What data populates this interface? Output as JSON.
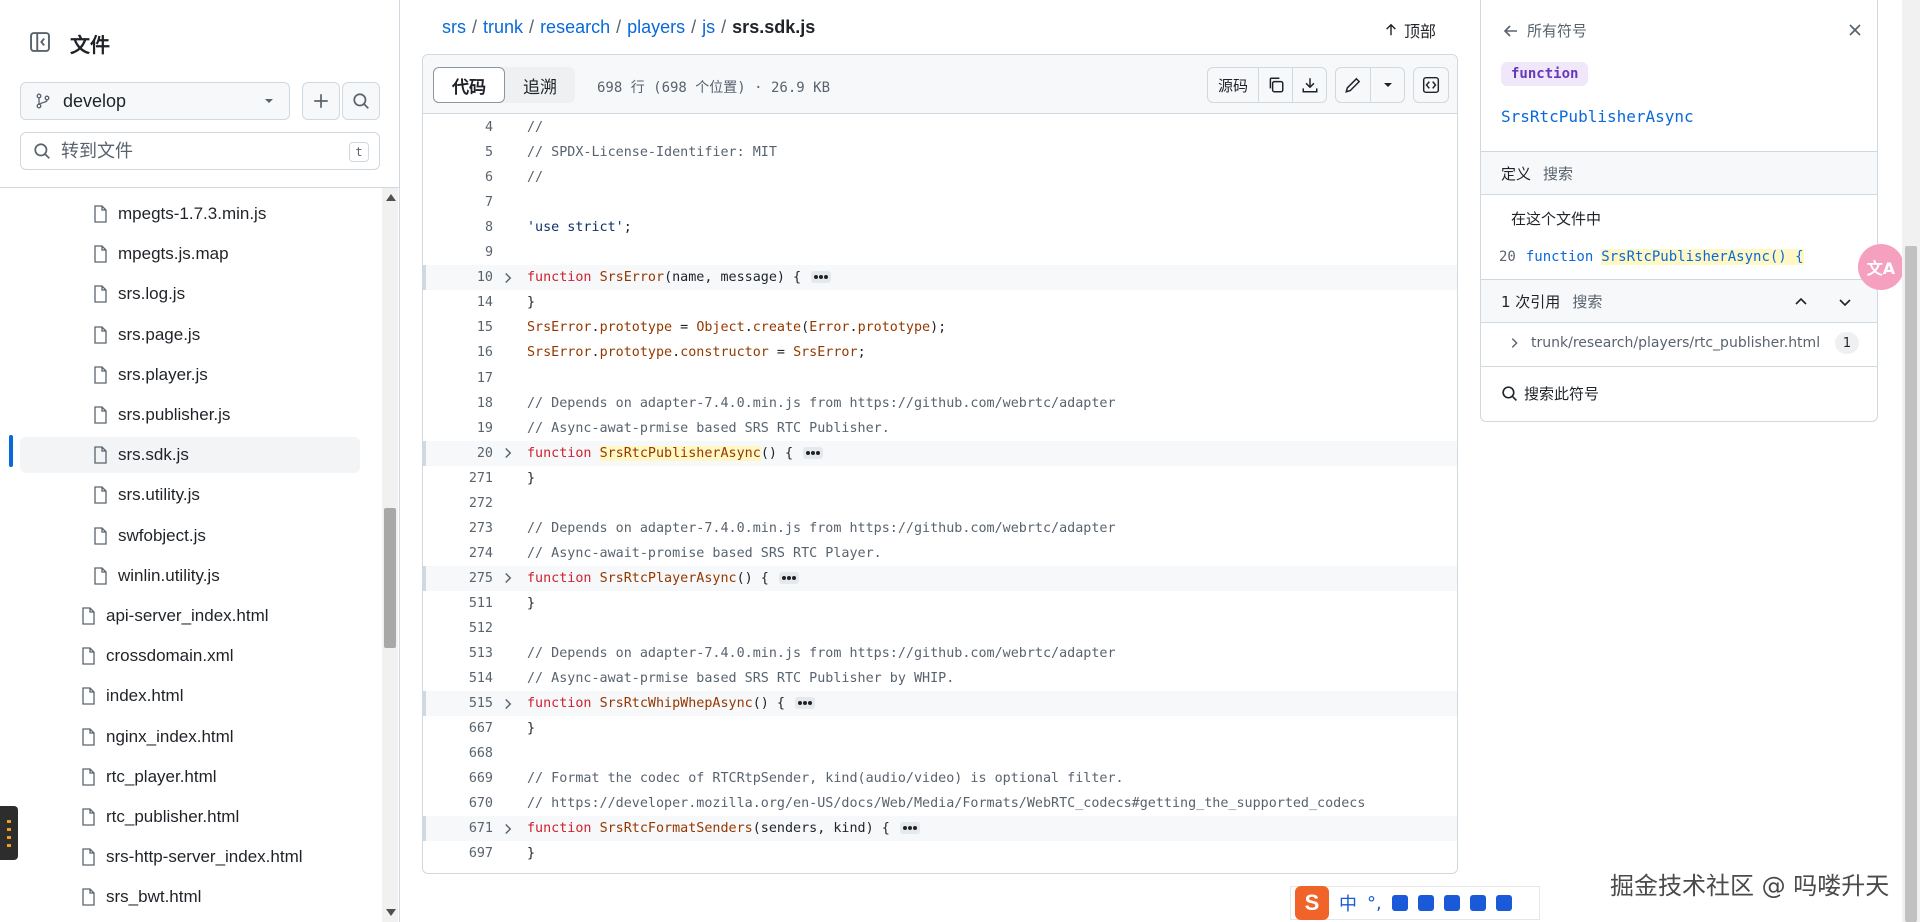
{
  "sidebar": {
    "title": "文件",
    "branch": "develop",
    "goto_placeholder": "转到文件",
    "goto_shortcut": "t",
    "items": [
      {
        "label": "mpegts-1.7.3.min.js",
        "indent": 2
      },
      {
        "label": "mpegts.js.map",
        "indent": 2
      },
      {
        "label": "srs.log.js",
        "indent": 2
      },
      {
        "label": "srs.page.js",
        "indent": 2
      },
      {
        "label": "srs.player.js",
        "indent": 2
      },
      {
        "label": "srs.publisher.js",
        "indent": 2
      },
      {
        "label": "srs.sdk.js",
        "indent": 2,
        "selected": true
      },
      {
        "label": "srs.utility.js",
        "indent": 2
      },
      {
        "label": "swfobject.js",
        "indent": 2
      },
      {
        "label": "winlin.utility.js",
        "indent": 2
      },
      {
        "label": "api-server_index.html",
        "indent": 1
      },
      {
        "label": "crossdomain.xml",
        "indent": 1
      },
      {
        "label": "index.html",
        "indent": 1
      },
      {
        "label": "nginx_index.html",
        "indent": 1
      },
      {
        "label": "rtc_player.html",
        "indent": 1
      },
      {
        "label": "rtc_publisher.html",
        "indent": 1
      },
      {
        "label": "srs-http-server_index.html",
        "indent": 1
      },
      {
        "label": "srs_bwt.html",
        "indent": 1
      }
    ]
  },
  "breadcrumb": {
    "parts": [
      "srs",
      "trunk",
      "research",
      "players",
      "js"
    ],
    "current": "srs.sdk.js",
    "top_label": "顶部"
  },
  "toolbar": {
    "tab_code": "代码",
    "tab_blame": "追溯",
    "meta": "698 行 (698 个位置) · 26.9 KB",
    "raw_label": "源码"
  },
  "code_lines": [
    {
      "n": "4",
      "t": [
        [
          "cm",
          "//"
        ]
      ]
    },
    {
      "n": "5",
      "t": [
        [
          "cm",
          "// SPDX-License-Identifier: MIT"
        ]
      ]
    },
    {
      "n": "6",
      "t": [
        [
          "cm",
          "//"
        ]
      ]
    },
    {
      "n": "7",
      "t": []
    },
    {
      "n": "8",
      "t": [
        [
          "st",
          "'use strict'"
        ],
        [
          "",
          ";"
        ]
      ]
    },
    {
      "n": "9",
      "t": []
    },
    {
      "n": "10",
      "fold": true,
      "t": [
        [
          "kw",
          "function "
        ],
        [
          "fn",
          "SrsError"
        ],
        [
          "",
          "(name, message) {"
        ]
      ]
    },
    {
      "n": "14",
      "t": [
        [
          "",
          "}"
        ]
      ]
    },
    {
      "n": "15",
      "t": [
        [
          "fn",
          "SrsError"
        ],
        [
          "",
          "."
        ],
        [
          "fn",
          "prototype"
        ],
        [
          "",
          " = "
        ],
        [
          "fn",
          "Object"
        ],
        [
          "",
          "."
        ],
        [
          "fn",
          "create"
        ],
        [
          "",
          "("
        ],
        [
          "fn",
          "Error"
        ],
        [
          "",
          "."
        ],
        [
          "fn",
          "prototype"
        ],
        [
          "",
          ");"
        ]
      ]
    },
    {
      "n": "16",
      "t": [
        [
          "fn",
          "SrsError"
        ],
        [
          "",
          "."
        ],
        [
          "fn",
          "prototype"
        ],
        [
          "",
          "."
        ],
        [
          "fn",
          "constructor"
        ],
        [
          "",
          " = "
        ],
        [
          "fn",
          "SrsError"
        ],
        [
          "",
          ";"
        ]
      ]
    },
    {
      "n": "17",
      "t": []
    },
    {
      "n": "18",
      "t": [
        [
          "cm",
          "// Depends on adapter-7.4.0.min.js from https://github.com/webrtc/adapter"
        ]
      ]
    },
    {
      "n": "19",
      "t": [
        [
          "cm",
          "// Async-awat-prmise based SRS RTC Publisher."
        ]
      ]
    },
    {
      "n": "20",
      "fold": true,
      "t": [
        [
          "kw",
          "function "
        ],
        [
          "fn hl",
          "SrsRtcPublisherAsync"
        ],
        [
          "",
          "() {"
        ]
      ]
    },
    {
      "n": "271",
      "t": [
        [
          "",
          "}"
        ]
      ]
    },
    {
      "n": "272",
      "t": []
    },
    {
      "n": "273",
      "t": [
        [
          "cm",
          "// Depends on adapter-7.4.0.min.js from https://github.com/webrtc/adapter"
        ]
      ]
    },
    {
      "n": "274",
      "t": [
        [
          "cm",
          "// Async-await-promise based SRS RTC Player."
        ]
      ]
    },
    {
      "n": "275",
      "fold": true,
      "t": [
        [
          "kw",
          "function "
        ],
        [
          "fn",
          "SrsRtcPlayerAsync"
        ],
        [
          "",
          "() {"
        ]
      ]
    },
    {
      "n": "511",
      "t": [
        [
          "",
          "}"
        ]
      ]
    },
    {
      "n": "512",
      "t": []
    },
    {
      "n": "513",
      "t": [
        [
          "cm",
          "// Depends on adapter-7.4.0.min.js from https://github.com/webrtc/adapter"
        ]
      ]
    },
    {
      "n": "514",
      "t": [
        [
          "cm",
          "// Async-awat-prmise based SRS RTC Publisher by WHIP."
        ]
      ]
    },
    {
      "n": "515",
      "fold": true,
      "t": [
        [
          "kw",
          "function "
        ],
        [
          "fn",
          "SrsRtcWhipWhepAsync"
        ],
        [
          "",
          "() {"
        ]
      ]
    },
    {
      "n": "667",
      "t": [
        [
          "",
          "}"
        ]
      ]
    },
    {
      "n": "668",
      "t": []
    },
    {
      "n": "669",
      "t": [
        [
          "cm",
          "// Format the codec of RTCRtpSender, kind(audio/video) is optional filter."
        ]
      ]
    },
    {
      "n": "670",
      "t": [
        [
          "cm",
          "// https://developer.mozilla.org/en-US/docs/Web/Media/Formats/WebRTC_codecs#getting_the_supported_codecs"
        ]
      ]
    },
    {
      "n": "671",
      "fold": true,
      "t": [
        [
          "kw",
          "function "
        ],
        [
          "fn",
          "SrsRtcFormatSenders"
        ],
        [
          "",
          "(senders, kind) {"
        ]
      ]
    },
    {
      "n": "697",
      "t": [
        [
          "",
          "}"
        ]
      ]
    }
  ],
  "symbols": {
    "back_label": "所有符号",
    "kind": "function",
    "name": "SrsRtcPublisherAsync",
    "def_title": "定义",
    "def_search": "搜索",
    "in_file": "在这个文件中",
    "def_line_no": "20",
    "def_line_kw": "function",
    "def_line_name": "SrsRtcPublisherAsync() {",
    "ref_title": "1 次引用",
    "ref_search": "搜索",
    "ref_path": "trunk/research/players/rtc_publisher.html",
    "ref_count": "1",
    "search_symbol": "搜索此符号"
  },
  "ime": {
    "items": [
      "中",
      "°,"
    ]
  },
  "watermark": "掘金技术社区 @ 吗喽升天",
  "translate_fab": "文A"
}
